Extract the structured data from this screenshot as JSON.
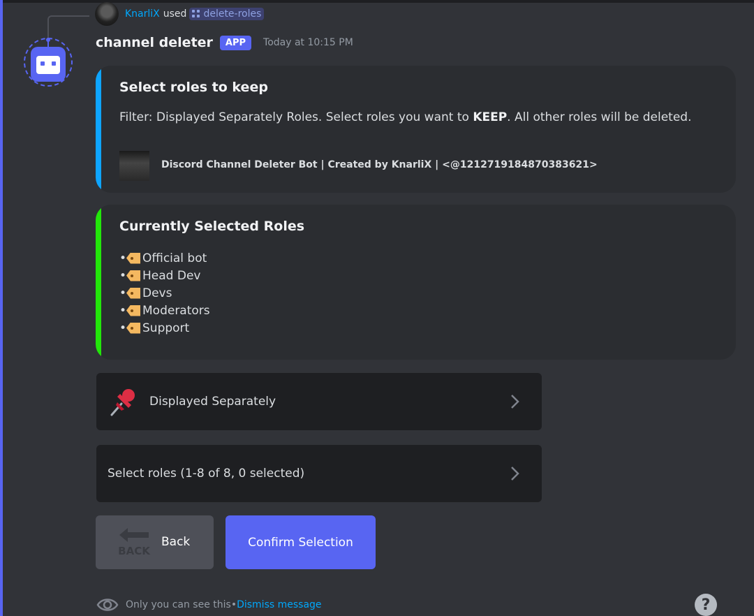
{
  "invocation": {
    "username": "KnarliX",
    "used": "used",
    "command": "delete-roles"
  },
  "message": {
    "bot_name": "channel deleter",
    "app_badge": "APP",
    "timestamp": "Today at 10:15 PM"
  },
  "embed1": {
    "title": "Select roles to keep",
    "desc_prefix": "Filter: Displayed Separately Roles. Select roles you want to ",
    "desc_bold": "KEEP",
    "desc_suffix": ". All other roles will be deleted.",
    "footer": "Discord Channel Deleter Bot | Created by KnarliX | <@1212719184870383621>",
    "accent": "#0ea5ff"
  },
  "embed2": {
    "title": "Currently Selected Roles",
    "roles": [
      "Official bot",
      "Head Dev",
      "Devs",
      "Moderators",
      "Support"
    ],
    "accent": "#22e60a"
  },
  "select_filter": {
    "label": "Displayed Separately",
    "icon": "pushpin-icon"
  },
  "select_roles": {
    "label": "Select roles (1-8 of 8, 0 selected)"
  },
  "buttons": {
    "back": "Back",
    "back_emoji_text": "BACK",
    "confirm": "Confirm Selection"
  },
  "ephemeral": {
    "notice": "Only you can see this",
    "separator": " • ",
    "dismiss": "Dismiss message"
  },
  "colors": {
    "blurple": "#5865f2",
    "background": "#313338",
    "embed_bg": "#2b2d31"
  }
}
